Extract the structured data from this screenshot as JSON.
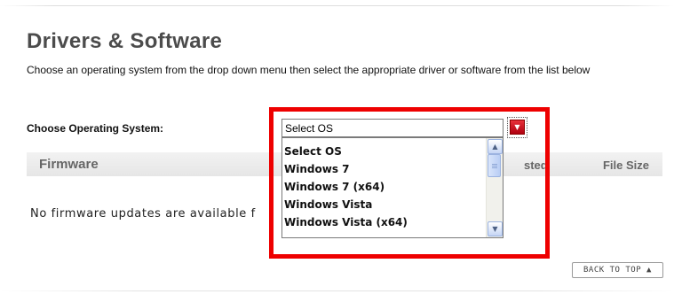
{
  "page": {
    "title": "Drivers & Software",
    "intro": "Choose an operating system from the drop down menu then select the appropriate driver or software from the list below"
  },
  "os_selector": {
    "label": "Choose Operating System:",
    "selected": "Select OS",
    "options": [
      "Select OS",
      "Windows 7",
      "Windows 7 (x64)",
      "Windows Vista",
      "Windows Vista (x64)"
    ],
    "dropdown_icon": "chevron-down-icon",
    "highlight_color": "#ee0000"
  },
  "firmware_section": {
    "title": "Firmware",
    "col_date_partial": "sted",
    "col_size": "File Size",
    "empty_message": "No firmware updates are available f"
  },
  "back_to_top": {
    "label": "BACK TO TOP",
    "icon": "caret-up-icon"
  },
  "colors": {
    "accent_red": "#d0101c",
    "section_bar": "#eaeaea",
    "heading_gray": "#4c4c4c"
  }
}
